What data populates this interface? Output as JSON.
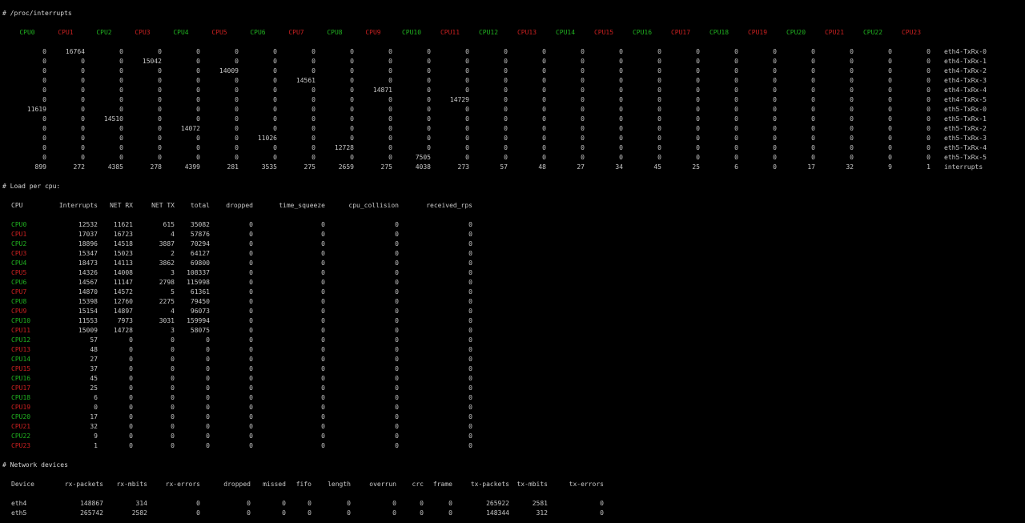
{
  "colors": {
    "even_cpu": "#20b020",
    "odd_cpu": "#c82020",
    "text": "#c8c8c8",
    "background": "#000000"
  },
  "interrupts": {
    "title": "# /proc/interrupts",
    "headers": [
      "CPU0",
      "CPU1",
      "CPU2",
      "CPU3",
      "CPU4",
      "CPU5",
      "CPU6",
      "CPU7",
      "CPU8",
      "CPU9",
      "CPU10",
      "CPU11",
      "CPU12",
      "CPU13",
      "CPU14",
      "CPU15",
      "CPU16",
      "CPU17",
      "CPU18",
      "CPU19",
      "CPU20",
      "CPU21",
      "CPU22",
      "CPU23"
    ],
    "rows": [
      {
        "label": "eth4-TxRx-0",
        "values": [
          "0",
          "16764",
          "0",
          "0",
          "0",
          "0",
          "0",
          "0",
          "0",
          "0",
          "0",
          "0",
          "0",
          "0",
          "0",
          "0",
          "0",
          "0",
          "0",
          "0",
          "0",
          "0",
          "0",
          "0"
        ]
      },
      {
        "label": "eth4-TxRx-1",
        "values": [
          "0",
          "0",
          "0",
          "15042",
          "0",
          "0",
          "0",
          "0",
          "0",
          "0",
          "0",
          "0",
          "0",
          "0",
          "0",
          "0",
          "0",
          "0",
          "0",
          "0",
          "0",
          "0",
          "0",
          "0"
        ]
      },
      {
        "label": "eth4-TxRx-2",
        "values": [
          "0",
          "0",
          "0",
          "0",
          "0",
          "14009",
          "0",
          "0",
          "0",
          "0",
          "0",
          "0",
          "0",
          "0",
          "0",
          "0",
          "0",
          "0",
          "0",
          "0",
          "0",
          "0",
          "0",
          "0"
        ]
      },
      {
        "label": "eth4-TxRx-3",
        "values": [
          "0",
          "0",
          "0",
          "0",
          "0",
          "0",
          "0",
          "14561",
          "0",
          "0",
          "0",
          "0",
          "0",
          "0",
          "0",
          "0",
          "0",
          "0",
          "0",
          "0",
          "0",
          "0",
          "0",
          "0"
        ]
      },
      {
        "label": "eth4-TxRx-4",
        "values": [
          "0",
          "0",
          "0",
          "0",
          "0",
          "0",
          "0",
          "0",
          "0",
          "14871",
          "0",
          "0",
          "0",
          "0",
          "0",
          "0",
          "0",
          "0",
          "0",
          "0",
          "0",
          "0",
          "0",
          "0"
        ]
      },
      {
        "label": "eth4-TxRx-5",
        "values": [
          "0",
          "0",
          "0",
          "0",
          "0",
          "0",
          "0",
          "0",
          "0",
          "0",
          "0",
          "14729",
          "0",
          "0",
          "0",
          "0",
          "0",
          "0",
          "0",
          "0",
          "0",
          "0",
          "0",
          "0"
        ]
      },
      {
        "label": "eth5-TxRx-0",
        "values": [
          "11619",
          "0",
          "0",
          "0",
          "0",
          "0",
          "0",
          "0",
          "0",
          "0",
          "0",
          "0",
          "0",
          "0",
          "0",
          "0",
          "0",
          "0",
          "0",
          "0",
          "0",
          "0",
          "0",
          "0"
        ]
      },
      {
        "label": "eth5-TxRx-1",
        "values": [
          "0",
          "0",
          "14510",
          "0",
          "0",
          "0",
          "0",
          "0",
          "0",
          "0",
          "0",
          "0",
          "0",
          "0",
          "0",
          "0",
          "0",
          "0",
          "0",
          "0",
          "0",
          "0",
          "0",
          "0"
        ]
      },
      {
        "label": "eth5-TxRx-2",
        "values": [
          "0",
          "0",
          "0",
          "0",
          "14072",
          "0",
          "0",
          "0",
          "0",
          "0",
          "0",
          "0",
          "0",
          "0",
          "0",
          "0",
          "0",
          "0",
          "0",
          "0",
          "0",
          "0",
          "0",
          "0"
        ]
      },
      {
        "label": "eth5-TxRx-3",
        "values": [
          "0",
          "0",
          "0",
          "0",
          "0",
          "0",
          "11026",
          "0",
          "0",
          "0",
          "0",
          "0",
          "0",
          "0",
          "0",
          "0",
          "0",
          "0",
          "0",
          "0",
          "0",
          "0",
          "0",
          "0"
        ]
      },
      {
        "label": "eth5-TxRx-4",
        "values": [
          "0",
          "0",
          "0",
          "0",
          "0",
          "0",
          "0",
          "0",
          "12728",
          "0",
          "0",
          "0",
          "0",
          "0",
          "0",
          "0",
          "0",
          "0",
          "0",
          "0",
          "0",
          "0",
          "0",
          "0"
        ]
      },
      {
        "label": "eth5-TxRx-5",
        "values": [
          "0",
          "0",
          "0",
          "0",
          "0",
          "0",
          "0",
          "0",
          "0",
          "0",
          "7505",
          "0",
          "0",
          "0",
          "0",
          "0",
          "0",
          "0",
          "0",
          "0",
          "0",
          "0",
          "0",
          "0"
        ]
      },
      {
        "label": "interrupts",
        "values": [
          "899",
          "272",
          "4385",
          "278",
          "4399",
          "281",
          "3535",
          "275",
          "2659",
          "275",
          "4038",
          "273",
          "57",
          "48",
          "27",
          "34",
          "45",
          "25",
          "6",
          "0",
          "17",
          "32",
          "9",
          "1"
        ]
      }
    ]
  },
  "load": {
    "title": "# Load per cpu:",
    "headers": [
      "CPU",
      "Interrupts",
      "NET RX",
      "NET TX",
      "total",
      "dropped",
      "time_squeeze",
      "cpu_collision",
      "received_rps"
    ],
    "rows": [
      [
        "CPU0",
        "12532",
        "11621",
        "615",
        "35082",
        "0",
        "0",
        "0",
        "0"
      ],
      [
        "CPU1",
        "17037",
        "16723",
        "4",
        "57876",
        "0",
        "0",
        "0",
        "0"
      ],
      [
        "CPU2",
        "18896",
        "14518",
        "3887",
        "70294",
        "0",
        "0",
        "0",
        "0"
      ],
      [
        "CPU3",
        "15347",
        "15023",
        "2",
        "64127",
        "0",
        "0",
        "0",
        "0"
      ],
      [
        "CPU4",
        "18473",
        "14113",
        "3862",
        "69800",
        "0",
        "0",
        "0",
        "0"
      ],
      [
        "CPU5",
        "14326",
        "14008",
        "3",
        "108337",
        "0",
        "0",
        "0",
        "0"
      ],
      [
        "CPU6",
        "14567",
        "11147",
        "2798",
        "115998",
        "0",
        "0",
        "0",
        "0"
      ],
      [
        "CPU7",
        "14870",
        "14572",
        "5",
        "61361",
        "0",
        "0",
        "0",
        "0"
      ],
      [
        "CPU8",
        "15398",
        "12760",
        "2275",
        "79450",
        "0",
        "0",
        "0",
        "0"
      ],
      [
        "CPU9",
        "15154",
        "14897",
        "4",
        "96073",
        "0",
        "0",
        "0",
        "0"
      ],
      [
        "CPU10",
        "11553",
        "7973",
        "3031",
        "159994",
        "0",
        "0",
        "0",
        "0"
      ],
      [
        "CPU11",
        "15009",
        "14728",
        "3",
        "58075",
        "0",
        "0",
        "0",
        "0"
      ],
      [
        "CPU12",
        "57",
        "0",
        "0",
        "0",
        "0",
        "0",
        "0",
        "0"
      ],
      [
        "CPU13",
        "48",
        "0",
        "0",
        "0",
        "0",
        "0",
        "0",
        "0"
      ],
      [
        "CPU14",
        "27",
        "0",
        "0",
        "0",
        "0",
        "0",
        "0",
        "0"
      ],
      [
        "CPU15",
        "37",
        "0",
        "0",
        "0",
        "0",
        "0",
        "0",
        "0"
      ],
      [
        "CPU16",
        "45",
        "0",
        "0",
        "0",
        "0",
        "0",
        "0",
        "0"
      ],
      [
        "CPU17",
        "25",
        "0",
        "0",
        "0",
        "0",
        "0",
        "0",
        "0"
      ],
      [
        "CPU18",
        "6",
        "0",
        "0",
        "0",
        "0",
        "0",
        "0",
        "0"
      ],
      [
        "CPU19",
        "0",
        "0",
        "0",
        "0",
        "0",
        "0",
        "0",
        "0"
      ],
      [
        "CPU20",
        "17",
        "0",
        "0",
        "0",
        "0",
        "0",
        "0",
        "0"
      ],
      [
        "CPU21",
        "32",
        "0",
        "0",
        "0",
        "0",
        "0",
        "0",
        "0"
      ],
      [
        "CPU22",
        "9",
        "0",
        "0",
        "0",
        "0",
        "0",
        "0",
        "0"
      ],
      [
        "CPU23",
        "1",
        "0",
        "0",
        "0",
        "0",
        "0",
        "0",
        "0"
      ]
    ]
  },
  "network": {
    "title": "# Network devices",
    "headers": [
      "Device",
      "rx-packets",
      "rx-mbits",
      "rx-errors",
      "dropped",
      "missed",
      "fifo",
      "length",
      "overrun",
      "crc",
      "frame",
      "tx-packets",
      "tx-mbits",
      "tx-errors"
    ],
    "rows": [
      [
        "eth4",
        "148867",
        "314",
        "0",
        "0",
        "0",
        "0",
        "0",
        "0",
        "0",
        "0",
        "265922",
        "2581",
        "0"
      ],
      [
        "eth5",
        "265742",
        "2582",
        "0",
        "0",
        "0",
        "0",
        "0",
        "0",
        "0",
        "0",
        "148344",
        "312",
        "0"
      ]
    ]
  }
}
